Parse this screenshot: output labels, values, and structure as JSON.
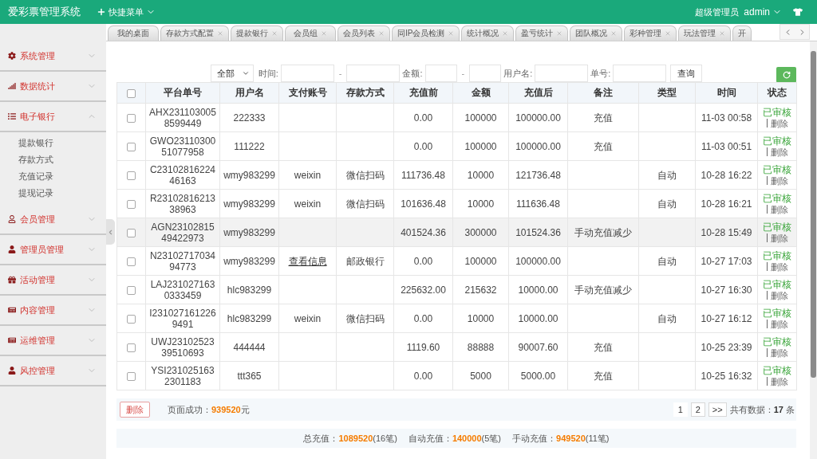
{
  "header": {
    "title": "爱彩票管理系统",
    "quick_menu": "快捷菜单",
    "role": "超级管理员",
    "user": "admin"
  },
  "tabs": [
    {
      "label": "我的桌面",
      "closable": false,
      "selected": false
    },
    {
      "label": "存款方式配置",
      "closable": true,
      "selected": false
    },
    {
      "label": "提款银行",
      "closable": true,
      "selected": false
    },
    {
      "label": "会员组",
      "closable": true,
      "selected": false
    },
    {
      "label": "会员列表",
      "closable": true,
      "selected": false
    },
    {
      "label": "同IP会员检测",
      "closable": true,
      "selected": false
    },
    {
      "label": "统计概况",
      "closable": true,
      "selected": false
    },
    {
      "label": "盈亏统计",
      "closable": true,
      "selected": false
    },
    {
      "label": "团队概况",
      "closable": true,
      "selected": false
    },
    {
      "label": "彩种管理",
      "closable": true,
      "selected": false
    },
    {
      "label": "玩法管理",
      "closable": true,
      "selected": false
    },
    {
      "label": "开",
      "closable": false,
      "selected": false
    }
  ],
  "sidebar": {
    "items": [
      {
        "label": "系统管理",
        "expanded": false
      },
      {
        "label": "数据统计",
        "expanded": false
      },
      {
        "label": "电子银行",
        "expanded": true,
        "children": [
          {
            "label": "提款银行",
            "selected": false
          },
          {
            "label": "存款方式",
            "selected": false
          },
          {
            "label": "充值记录",
            "selected": false
          },
          {
            "label": "提现记录",
            "selected": false
          }
        ]
      },
      {
        "label": "会员管理",
        "expanded": false
      },
      {
        "label": "管理员管理",
        "expanded": false
      },
      {
        "label": "活动管理",
        "expanded": false
      },
      {
        "label": "内容管理",
        "expanded": false
      },
      {
        "label": "运维管理",
        "expanded": false
      },
      {
        "label": "风控管理",
        "expanded": false
      }
    ]
  },
  "filter": {
    "type_select": "全部",
    "time_label": "时间:",
    "time_separator": "-",
    "amount_label": "金额:",
    "amount_separator": "-",
    "username_label": "用户名:",
    "order_label": "单号:",
    "search_button": "查询"
  },
  "table": {
    "select_all_checked": false,
    "columns": [
      "平台单号",
      "用户名",
      "支付账号",
      "存款方式",
      "充值前",
      "金额",
      "充值后",
      "备注",
      "类型",
      "时间",
      "状态"
    ],
    "rows": [
      {
        "checked": false,
        "highlighted": false,
        "order_no": "AHX2311030058599449",
        "username": "222333",
        "before": "0.00",
        "amount": "100000",
        "after": "100000.00",
        "note": "充值",
        "time": "11-03 00:58",
        "status": "已审核",
        "action": "删除"
      },
      {
        "checked": false,
        "highlighted": false,
        "order_no": "GWO2311030051077958",
        "username": "111222",
        "before": "0.00",
        "amount": "100000",
        "after": "100000.00",
        "note": "充值",
        "time": "11-03 00:51",
        "status": "已审核",
        "action": "删除"
      },
      {
        "checked": false,
        "highlighted": false,
        "order_no": "C2310281622446163",
        "username": "wmy983299",
        "pay_account": {
          "kind": "text",
          "text": "weixin"
        },
        "method": "微信扫码",
        "before": "111736.48",
        "amount": "10000",
        "after": "121736.48",
        "type": "自动",
        "time": "10-28 16:22",
        "status": "已审核",
        "action": "删除"
      },
      {
        "checked": false,
        "highlighted": false,
        "order_no": "R2310281621338963",
        "username": "wmy983299",
        "pay_account": {
          "kind": "text",
          "text": "weixin"
        },
        "method": "微信扫码",
        "before": "101636.48",
        "amount": "10000",
        "after": "111636.48",
        "type": "自动",
        "time": "10-28 16:21",
        "status": "已审核",
        "action": "删除"
      },
      {
        "checked": false,
        "highlighted": true,
        "order_no": "AGN2310281549422973",
        "username": "wmy983299",
        "before": "401524.36",
        "amount": "300000",
        "after": "101524.36",
        "note": "手动充值减少",
        "time": "10-28 15:49",
        "status": "已审核",
        "action": "删除"
      },
      {
        "checked": false,
        "highlighted": false,
        "order_no": "N2310271703494773",
        "username": "wmy983299",
        "pay_account": {
          "kind": "link",
          "text": "查看信息"
        },
        "method": "邮政银行",
        "before": "0.00",
        "amount": "100000",
        "after": "100000.00",
        "type": "自动",
        "time": "10-27 17:03",
        "status": "已审核",
        "action": "删除"
      },
      {
        "checked": false,
        "highlighted": false,
        "order_no": "LAJ2310271630333459",
        "username": "hlc983299",
        "before": "225632.00",
        "amount": "215632",
        "after": "10000.00",
        "note": "手动充值减少",
        "time": "10-27 16:30",
        "status": "已审核",
        "action": "删除"
      },
      {
        "checked": false,
        "highlighted": false,
        "order_no": "I2310271612269491",
        "username": "hlc983299",
        "pay_account": {
          "kind": "text",
          "text": "weixin"
        },
        "method": "微信扫码",
        "before": "0.00",
        "amount": "10000",
        "after": "10000.00",
        "type": "自动",
        "time": "10-27 16:12",
        "status": "已审核",
        "action": "删除"
      },
      {
        "checked": false,
        "highlighted": false,
        "order_no": "UWJ2310252339510693",
        "username": "444444",
        "before": "1119.60",
        "amount": "88888",
        "after": "90007.60",
        "note": "充值",
        "time": "10-25 23:39",
        "status": "已审核",
        "action": "删除"
      },
      {
        "checked": false,
        "highlighted": false,
        "order_no": "YSI2310251632301183",
        "username": "ttt365",
        "before": "0.00",
        "amount": "5000",
        "after": "5000.00",
        "note": "充值",
        "time": "10-25 16:32",
        "status": "已审核",
        "action": "删除"
      }
    ]
  },
  "footer": {
    "delete_button": "删除",
    "page_total": "页面成功：**939520**元",
    "pages": [
      {
        "label": "1",
        "selected": true
      },
      {
        "label": "2",
        "selected": false
      },
      {
        "label": ">>",
        "selected": false
      }
    ],
    "total": "共有数据：**17** 条"
  },
  "summary": [
    "总充值：**1089520**(16笔)",
    "自动充值：**140000**(5笔)",
    "手动充值：**949520**(11笔)"
  ]
}
